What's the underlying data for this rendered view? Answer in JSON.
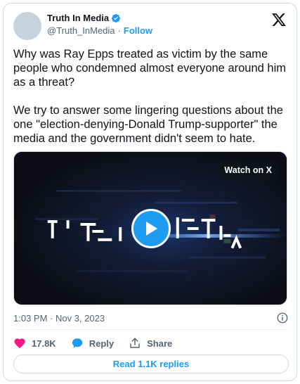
{
  "author": {
    "name": "Truth In Media",
    "handle": "@Truth_InMedia",
    "separator": "·",
    "follow_label": "Follow",
    "verified_icon": "verified-badge-icon",
    "verified_color": "#1d9bf0"
  },
  "platform_icon": "x-logo-icon",
  "tweet": {
    "paragraphs": [
      "Why was Ray Epps treated as victim by the same people who condemned almost everyone around him as a threat?",
      "We try to answer some lingering questions about the one \"election-denying-Donald Trump-supporter\" the media and the government didn't seem to hate."
    ]
  },
  "video": {
    "watch_label": "Watch on X",
    "play_icon": "play-icon",
    "accent_color": "#1d9bf0"
  },
  "meta": {
    "timestamp": "1:03 PM · Nov 3, 2023",
    "info_icon": "info-icon"
  },
  "actions": {
    "likes_count": "17.8K",
    "like_icon": "heart-icon",
    "like_color": "#f91880",
    "reply_label": "Reply",
    "reply_icon": "speech-bubble-icon",
    "share_label": "Share",
    "share_icon": "share-icon"
  },
  "replies_button_label": "Read 1.1K replies"
}
